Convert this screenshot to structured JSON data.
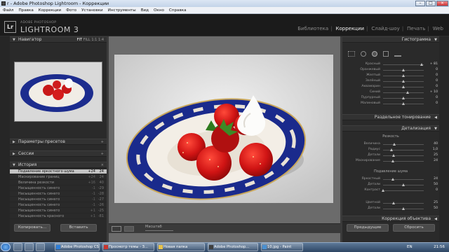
{
  "window": {
    "title": "r - Adobe Photoshop Lightroom - Коррекции"
  },
  "menu": [
    "Файл",
    "Правка",
    "Коррекции",
    "Фото",
    "Установки",
    "Инструменты",
    "Вид",
    "Окно",
    "Справка"
  ],
  "brand": {
    "sub": "ADOBE PHOTOSHOP",
    "name": "LIGHTROOM 3",
    "logo": "Lr"
  },
  "modules": [
    {
      "label": "Библиотека",
      "active": false
    },
    {
      "label": "Коррекции",
      "active": true
    },
    {
      "label": "Слайд-шоу",
      "active": false
    },
    {
      "label": "Печать",
      "active": false
    },
    {
      "label": "Web",
      "active": false
    }
  ],
  "left": {
    "navigator": {
      "title": "Навигатор",
      "zooms": [
        "FIT",
        "FILL",
        "1:1",
        "1:4"
      ]
    },
    "presets": "Параметры пресетов",
    "snapshots": "Сессии",
    "history": {
      "title": "История",
      "clear": "×",
      "items": [
        {
          "label": "Подавление яркостного шума",
          "a": "+24",
          "b": "24",
          "selected": true
        },
        {
          "label": "Маскирование границ",
          "a": "+24",
          "b": "24"
        },
        {
          "label": "Величина резкости",
          "a": "+16",
          "b": "40"
        },
        {
          "label": "Насыщенность синего",
          "a": "-1",
          "b": "-29"
        },
        {
          "label": "Насыщенность синего",
          "a": "-1",
          "b": "-28"
        },
        {
          "label": "Насыщенность синего",
          "a": "-1",
          "b": "-27"
        },
        {
          "label": "Насыщенность синего",
          "a": "-1",
          "b": "-26"
        },
        {
          "label": "Насыщенность синего",
          "a": "+1",
          "b": "-25"
        },
        {
          "label": "Насыщенность красного",
          "a": "+1",
          "b": "-81"
        }
      ]
    },
    "copy_btn": "Копировать...",
    "paste_btn": "Вставить"
  },
  "center": {
    "toolbar": {
      "zoom_label": "Масштаб"
    }
  },
  "right": {
    "histogram": "Гистограмма",
    "hsl_rows": [
      {
        "label": "Красный",
        "value": "+ 81",
        "pos": 0.95
      },
      {
        "label": "Оранжевый",
        "value": "0",
        "pos": 0.5
      },
      {
        "label": "Желтый",
        "value": "0",
        "pos": 0.5
      },
      {
        "label": "Зелёный",
        "value": "0",
        "pos": 0.5
      },
      {
        "label": "Аквамарин",
        "value": "0",
        "pos": 0.5
      },
      {
        "label": "Синий",
        "value": "+ 10",
        "pos": 0.6
      },
      {
        "label": "Пурпурный",
        "value": "0",
        "pos": 0.5
      },
      {
        "label": "Малиновый",
        "value": "0",
        "pos": 0.5
      }
    ],
    "split_toning": "Раздельное тонирование",
    "detail": {
      "title": "Детализация",
      "sharpening": "Резкость",
      "sharp_rows": [
        {
          "label": "Величина",
          "value": "40",
          "pos": 0.27
        },
        {
          "label": "Радиус",
          "value": "1,0",
          "pos": 0.2
        },
        {
          "label": "Детали",
          "value": "25",
          "pos": 0.25
        },
        {
          "label": "Маскирование",
          "value": "24",
          "pos": 0.24
        }
      ],
      "noise": "Подавление шума",
      "noise_rows": [
        {
          "label": "Яркостный",
          "value": "24",
          "pos": 0.24
        },
        {
          "label": "Детали",
          "value": "50",
          "pos": 0.5
        },
        {
          "label": "Контраст",
          "value": "0",
          "pos": 0.0
        },
        {
          "label": "Цветной",
          "value": "25",
          "pos": 0.25
        },
        {
          "label": "Детали",
          "value": "50",
          "pos": 0.5
        }
      ]
    },
    "lens": "Коррекция объектива",
    "prev_btn": "Предыдущие",
    "reset_btn": "Сбросить"
  },
  "taskbar": {
    "tasks": [
      {
        "label": "Adobe Photoshop CS4",
        "color": "#2e7dd6"
      },
      {
        "label": "Просмотр темы - З...",
        "color": "#c7352f"
      },
      {
        "label": "Новая папка",
        "color": "#e8c24a"
      },
      {
        "label": "Adobe Photoshop...",
        "color": "#3f3f3f"
      },
      {
        "label": "10.jpg - Paint",
        "color": "#4a90d0"
      }
    ],
    "lang": "EN",
    "time": "21:56"
  }
}
